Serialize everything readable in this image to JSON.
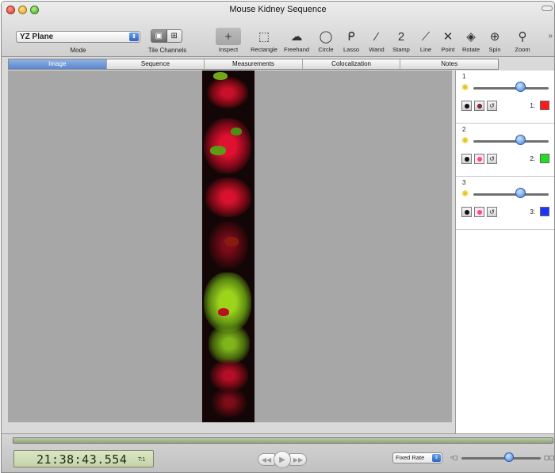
{
  "window": {
    "title": "Mouse Kidney Sequence"
  },
  "toolbar": {
    "mode_value": "YZ Plane",
    "mode_label": "Mode",
    "tile_label": "Tile Channels",
    "tools": [
      {
        "label": "Inspect",
        "icon": "crosshair-icon",
        "glyph": "+"
      },
      {
        "label": "Rectangle",
        "icon": "rectangle-select-icon",
        "glyph": "⬚"
      },
      {
        "label": "Freehand",
        "icon": "freehand-icon",
        "glyph": "☁"
      },
      {
        "label": "Circle",
        "icon": "circle-select-icon",
        "glyph": "◯"
      },
      {
        "label": "Lasso",
        "icon": "lasso-icon",
        "glyph": "ᑭ"
      },
      {
        "label": "Wand",
        "icon": "wand-icon",
        "glyph": "⁄"
      },
      {
        "label": "Stamp",
        "icon": "stamp-icon",
        "glyph": "2"
      },
      {
        "label": "Line",
        "icon": "line-icon",
        "glyph": "⟋"
      },
      {
        "label": "Point",
        "icon": "point-icon",
        "glyph": "✕"
      },
      {
        "label": "Rotate",
        "icon": "rotate-icon",
        "glyph": "◈"
      },
      {
        "label": "Spin",
        "icon": "spin-icon",
        "glyph": "⊕"
      },
      {
        "label": "Zoom",
        "icon": "zoom-icon",
        "glyph": "⚲"
      }
    ]
  },
  "tabs": [
    {
      "label": "Image",
      "active": true
    },
    {
      "label": "Sequence",
      "active": false
    },
    {
      "label": "Measurements",
      "active": false
    },
    {
      "label": "Colocalization",
      "active": false
    },
    {
      "label": "Notes",
      "active": false
    }
  ],
  "channels": [
    {
      "number": "1",
      "label": "1:",
      "color": "#ff1a1a",
      "slider": 0.62
    },
    {
      "number": "2",
      "label": "2:",
      "color": "#22dd22",
      "slider": 0.62
    },
    {
      "number": "3",
      "label": "3:",
      "color": "#1a33ff",
      "slider": 0.62
    }
  ],
  "playback": {
    "timecode": "21:38:43.554",
    "time_index": "T:1",
    "rate_value": "Fixed Rate",
    "zoom_level": 0.6
  }
}
